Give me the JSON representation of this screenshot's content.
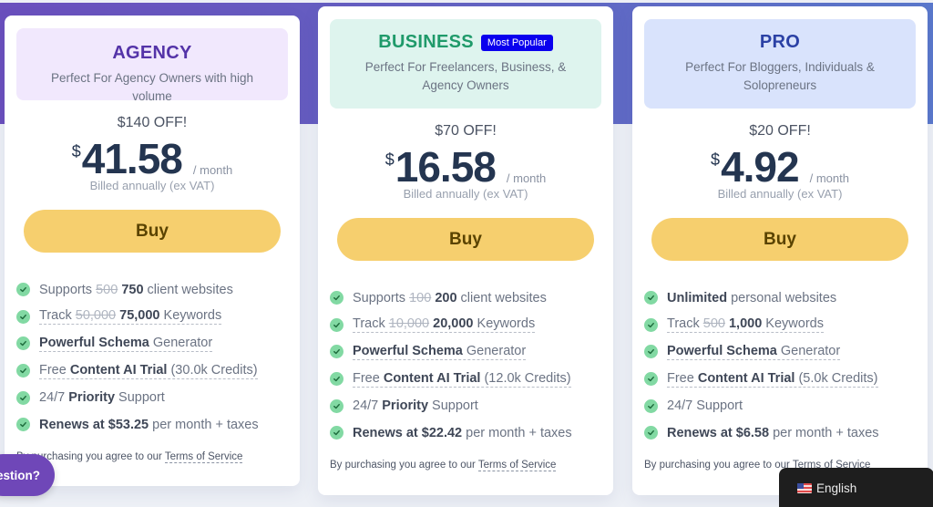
{
  "plans": [
    {
      "key": "agency",
      "title": "AGENCY",
      "badge": null,
      "description": "Perfect For Agency Owners with high volume",
      "discount": "$140 OFF!",
      "currency": "$",
      "price": "41.58",
      "period": "/ month",
      "billing": "Billed annually (ex VAT)",
      "buy_label": "Buy",
      "features": [
        {
          "parts": [
            {
              "t": "Supports "
            },
            {
              "t": "500",
              "s": true
            },
            {
              "t": " "
            },
            {
              "t": "750",
              "b": true
            },
            {
              "t": " client websites"
            }
          ],
          "dotted": false
        },
        {
          "parts": [
            {
              "t": "Track "
            },
            {
              "t": "50,000",
              "s": true
            },
            {
              "t": " "
            },
            {
              "t": "75,000",
              "b": true
            },
            {
              "t": " Keywords"
            }
          ],
          "dotted": true
        },
        {
          "parts": [
            {
              "t": "Powerful Schema",
              "b": true
            },
            {
              "t": " Generator"
            }
          ],
          "dotted": true
        },
        {
          "parts": [
            {
              "t": "Free "
            },
            {
              "t": "Content AI Trial",
              "b": true
            },
            {
              "t": " (30.0k Credits)"
            }
          ],
          "dotted": true
        },
        {
          "parts": [
            {
              "t": "24/7 "
            },
            {
              "t": "Priority",
              "b": true
            },
            {
              "t": " Support"
            }
          ],
          "dotted": false
        },
        {
          "parts": [
            {
              "t": "Renews at $53.25",
              "b": true
            },
            {
              "t": " per month + taxes"
            }
          ],
          "dotted": false
        }
      ],
      "tos_prefix": "By purchasing you agree to our ",
      "tos_link": "Terms of Service"
    },
    {
      "key": "business",
      "title": "BUSINESS",
      "badge": "Most Popular",
      "description": "Perfect For Freelancers, Business, & Agency Owners",
      "discount": "$70 OFF!",
      "currency": "$",
      "price": "16.58",
      "period": "/ month",
      "billing": "Billed annually (ex VAT)",
      "buy_label": "Buy",
      "features": [
        {
          "parts": [
            {
              "t": "Supports "
            },
            {
              "t": "100",
              "s": true
            },
            {
              "t": " "
            },
            {
              "t": "200",
              "b": true
            },
            {
              "t": " client websites"
            }
          ],
          "dotted": false
        },
        {
          "parts": [
            {
              "t": "Track "
            },
            {
              "t": "10,000",
              "s": true
            },
            {
              "t": " "
            },
            {
              "t": "20,000",
              "b": true
            },
            {
              "t": " Keywords"
            }
          ],
          "dotted": true
        },
        {
          "parts": [
            {
              "t": "Powerful Schema",
              "b": true
            },
            {
              "t": " Generator"
            }
          ],
          "dotted": true
        },
        {
          "parts": [
            {
              "t": "Free "
            },
            {
              "t": "Content AI Trial",
              "b": true
            },
            {
              "t": " (12.0k Credits)"
            }
          ],
          "dotted": true
        },
        {
          "parts": [
            {
              "t": "24/7 "
            },
            {
              "t": "Priority",
              "b": true
            },
            {
              "t": " Support"
            }
          ],
          "dotted": false
        },
        {
          "parts": [
            {
              "t": "Renews at $22.42",
              "b": true
            },
            {
              "t": " per month + taxes"
            }
          ],
          "dotted": false
        }
      ],
      "tos_prefix": "By purchasing you agree to our ",
      "tos_link": "Terms of Service"
    },
    {
      "key": "pro",
      "title": "PRO",
      "badge": null,
      "description": "Perfect For Bloggers, Individuals & Solopreneurs",
      "discount": "$20 OFF!",
      "currency": "$",
      "price": "4.92",
      "period": "/ month",
      "billing": "Billed annually (ex VAT)",
      "buy_label": "Buy",
      "features": [
        {
          "parts": [
            {
              "t": "Unlimited",
              "b": true
            },
            {
              "t": " personal websites"
            }
          ],
          "dotted": false
        },
        {
          "parts": [
            {
              "t": "Track "
            },
            {
              "t": "500",
              "s": true
            },
            {
              "t": " "
            },
            {
              "t": "1,000",
              "b": true
            },
            {
              "t": " Keywords"
            }
          ],
          "dotted": true
        },
        {
          "parts": [
            {
              "t": "Powerful Schema",
              "b": true
            },
            {
              "t": " Generator"
            }
          ],
          "dotted": true
        },
        {
          "parts": [
            {
              "t": "Free "
            },
            {
              "t": "Content AI Trial",
              "b": true
            },
            {
              "t": " (5.0k Credits)"
            }
          ],
          "dotted": true
        },
        {
          "parts": [
            {
              "t": "24/7 Support"
            }
          ],
          "dotted": false
        },
        {
          "parts": [
            {
              "t": "Renews at $6.58",
              "b": true
            },
            {
              "t": " per month + taxes"
            }
          ],
          "dotted": false
        }
      ],
      "tos_prefix": "By purchasing you agree to our ",
      "tos_link": "Terms of Service"
    }
  ],
  "chat_widget": {
    "label": "estion?",
    "icon": "question-chat-icon"
  },
  "language_switcher": {
    "label": "English",
    "flag": "us-flag-icon"
  },
  "colors": {
    "band_start": "#6a4fbd",
    "band_end": "#5a78cc",
    "buy_button": "#f6cf6e",
    "check": "#82d9a3",
    "badge": "#0a00ee"
  }
}
